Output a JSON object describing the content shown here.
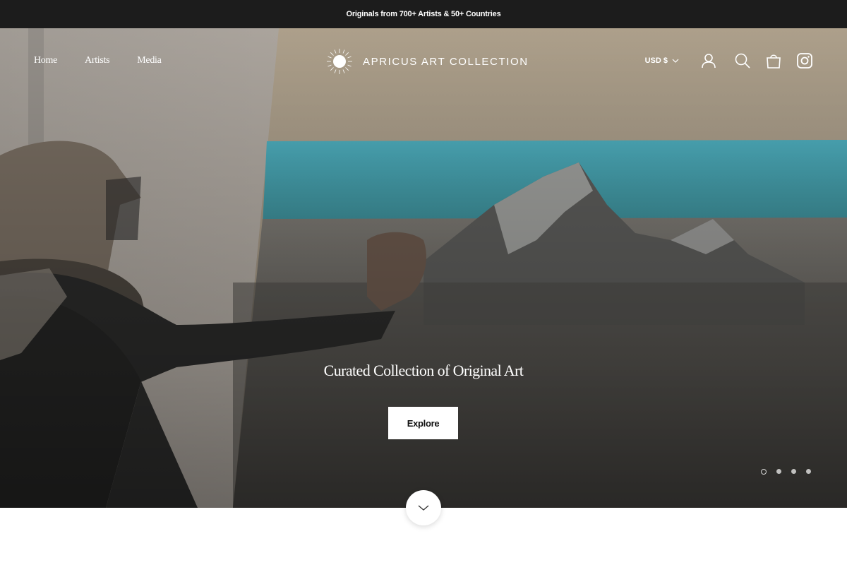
{
  "announcement": {
    "text": "Originals from 700+ Artists & 50+ Countries"
  },
  "nav": {
    "items": [
      {
        "label": "Home"
      },
      {
        "label": "Artists"
      },
      {
        "label": "Media"
      }
    ]
  },
  "logo": {
    "text": "APRICUS ART COLLECTION"
  },
  "utilities": {
    "currency": "USD $",
    "icons": [
      "account-icon",
      "search-icon",
      "cart-icon",
      "instagram-icon"
    ]
  },
  "hero": {
    "title": "Curated Collection of Original Art",
    "button_label": "Explore",
    "slides_total": 4,
    "active_slide": 1
  },
  "colors": {
    "announcement_bg": "#1c1c1c",
    "text_light": "#ffffff",
    "button_bg": "#ffffff"
  }
}
